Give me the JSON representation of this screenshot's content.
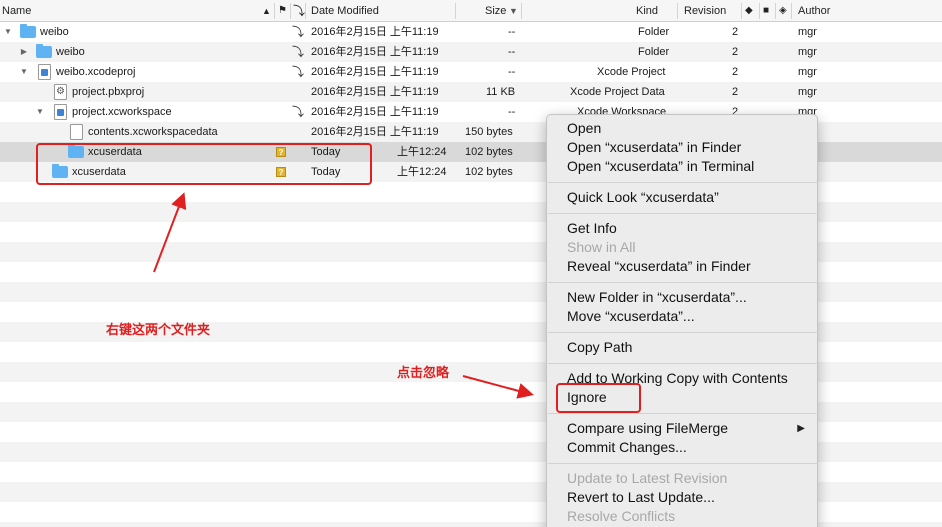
{
  "header": {
    "name": "Name",
    "date_modified": "Date Modified",
    "size": "Size",
    "kind": "Kind",
    "revision": "Revision",
    "author": "Author"
  },
  "rows": [
    {
      "name": "weibo",
      "date": "2016年2月15日 上午11:19",
      "size": "--",
      "kind": "Folder",
      "revision": "2",
      "author": "mgr"
    },
    {
      "name": "weibo",
      "date": "2016年2月15日 上午11:19",
      "size": "--",
      "kind": "Folder",
      "revision": "2",
      "author": "mgr"
    },
    {
      "name": "weibo.xcodeproj",
      "date": "2016年2月15日 上午11:19",
      "size": "--",
      "kind": "Xcode Project",
      "revision": "2",
      "author": "mgr"
    },
    {
      "name": "project.pbxproj",
      "date": "2016年2月15日 上午11:19",
      "size": "11 KB",
      "kind": "Xcode Project Data",
      "revision": "2",
      "author": "mgr"
    },
    {
      "name": "project.xcworkspace",
      "date": "2016年2月15日 上午11:19",
      "size": "--",
      "kind": "Xcode Workspace",
      "revision": "2",
      "author": "mgr"
    },
    {
      "name": "contents.xcworkspacedata",
      "date": "2016年2月15日 上午11:19",
      "size": "150 bytes"
    },
    {
      "name": "xcuserdata",
      "date": "Today",
      "time": "上午12:24",
      "size": "102 bytes"
    },
    {
      "name": "xcuserdata",
      "date": "Today",
      "time": "上午12:24",
      "size": "102 bytes"
    }
  ],
  "menu": {
    "open": "Open",
    "open_finder": "Open “xcuserdata” in Finder",
    "open_terminal": "Open “xcuserdata” in Terminal",
    "quick_look": "Quick Look “xcuserdata”",
    "get_info": "Get Info",
    "show_in_all": "Show in All",
    "reveal": "Reveal “xcuserdata” in Finder",
    "new_folder": "New Folder in “xcuserdata”...",
    "move": "Move “xcuserdata”...",
    "copy_path": "Copy Path",
    "add_working_copy": "Add to Working Copy with Contents",
    "ignore": "Ignore",
    "compare": "Compare using FileMerge",
    "commit": "Commit Changes...",
    "update_latest": "Update to Latest Revision",
    "revert": "Revert to Last Update...",
    "resolve": "Resolve Conflicts"
  },
  "annotations": {
    "right_click": "右键这两个文件夹",
    "click_ignore": "点击忽略"
  },
  "colors": {
    "annotation": "#e02020",
    "folder": "#5fb3f2",
    "selection": "#d9d9d9"
  }
}
